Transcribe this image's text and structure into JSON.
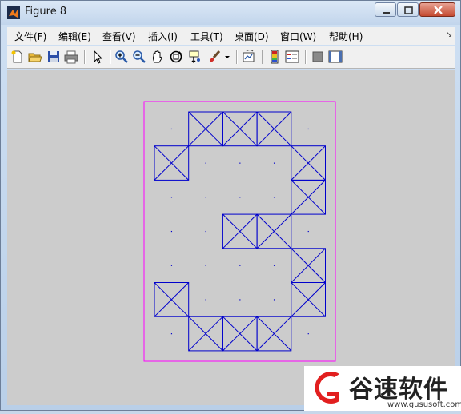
{
  "window": {
    "title": "Figure 8"
  },
  "menu": {
    "items": [
      "文件(F)",
      "编辑(E)",
      "查看(V)",
      "插入(I)",
      "工具(T)",
      "桌面(D)",
      "窗口(W)",
      "帮助(H)"
    ]
  },
  "toolbar": {
    "icons": [
      "new-figure-icon",
      "open-file-icon",
      "save-icon",
      "print-icon",
      "pointer-icon",
      "zoom-in-icon",
      "zoom-out-icon",
      "pan-hand-icon",
      "rotate-3d-icon",
      "data-cursor-icon",
      "brush-icon",
      "link-plot-icon",
      "colorbar-icon",
      "legend-icon",
      "hide-plot-tools-icon",
      "show-plot-tools-icon"
    ]
  },
  "colors": {
    "grid_box": "#0000cc",
    "border": "#ff00ff",
    "dot": "#0000cc",
    "background": "#cccccc"
  },
  "plot": {
    "grid_cols": 5,
    "grid_rows": 7,
    "filled_cells": [
      [
        1,
        0
      ],
      [
        2,
        0
      ],
      [
        3,
        0
      ],
      [
        0,
        1
      ],
      [
        4,
        1
      ],
      [
        4,
        2
      ],
      [
        2,
        3
      ],
      [
        3,
        3
      ],
      [
        4,
        4
      ],
      [
        0,
        5
      ],
      [
        4,
        5
      ],
      [
        1,
        6
      ],
      [
        2,
        6
      ],
      [
        3,
        6
      ]
    ]
  },
  "watermark": {
    "text": "谷速软件",
    "url": "www.gususoft.com"
  }
}
